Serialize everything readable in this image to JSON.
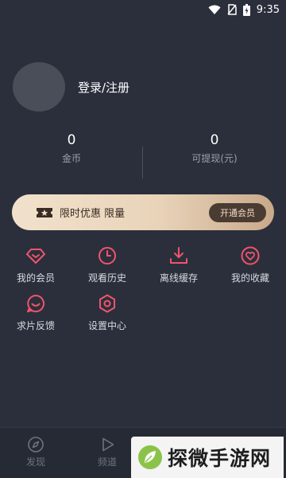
{
  "status_bar": {
    "time": "9:35",
    "icons": [
      "wifi-icon",
      "no-sim-icon",
      "battery-charging-icon"
    ]
  },
  "profile": {
    "login_label": "登录/注册"
  },
  "stats": [
    {
      "value": "0",
      "label": "金币"
    },
    {
      "value": "0",
      "label": "可提现(元)"
    }
  ],
  "vip_banner": {
    "text": "限时优惠 限量",
    "button": "开通会员",
    "icon": "ticket-star-icon"
  },
  "menu": [
    {
      "label": "我的会员",
      "icon": "diamond-icon"
    },
    {
      "label": "观看历史",
      "icon": "clock-icon"
    },
    {
      "label": "离线缓存",
      "icon": "download-icon"
    },
    {
      "label": "我的收藏",
      "icon": "heart-icon"
    },
    {
      "label": "求片反馈",
      "icon": "smile-chat-icon"
    },
    {
      "label": "设置中心",
      "icon": "gear-hex-icon"
    }
  ],
  "bottom_nav": [
    {
      "label": "发现",
      "icon": "compass-icon"
    },
    {
      "label": "频道",
      "icon": "play-icon"
    }
  ],
  "watermark": {
    "text": "探微手游网"
  },
  "colors": {
    "background": "#2b2f3b",
    "accent": "#f0546c",
    "vip_gold": "#e9d4ba"
  }
}
